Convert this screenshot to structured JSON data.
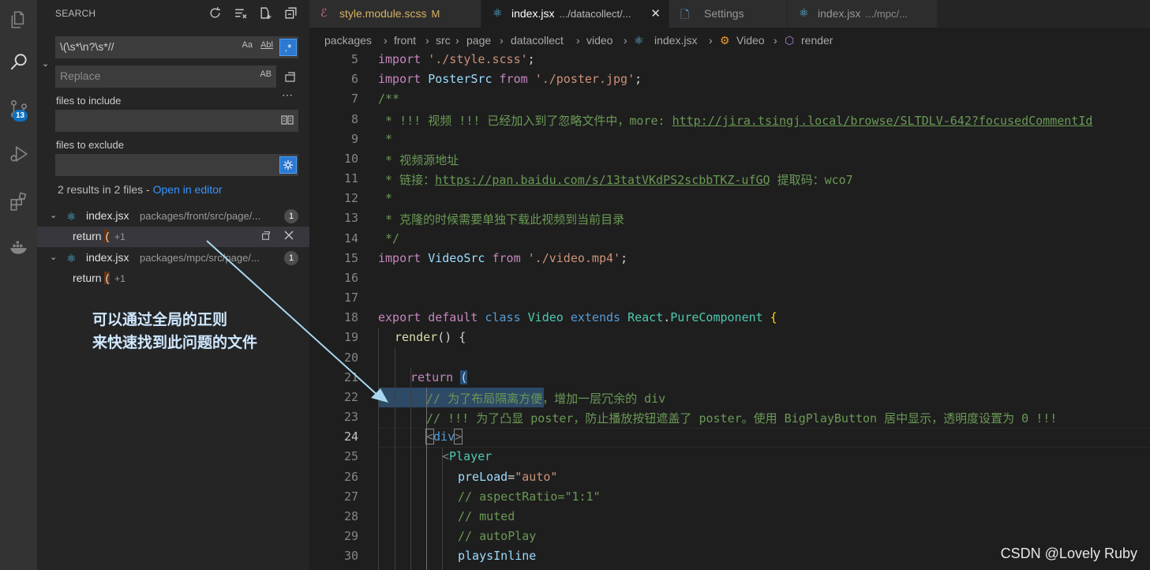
{
  "activity_bar": {
    "items": [
      "explorer-icon",
      "search-icon",
      "source-control-icon",
      "run-debug-icon",
      "extensions-icon",
      "docker-icon"
    ],
    "source_control_badge": "13"
  },
  "search": {
    "title": "SEARCH",
    "query": "\\(\\s*\\n?\\s*//",
    "replace_placeholder": "Replace",
    "match_case_label": "Aa",
    "whole_word_label": "Abl",
    "regex_label": ".*",
    "preserve_case_label": "AB",
    "files_to_include_label": "files to include",
    "files_to_exclude_label": "files to exclude",
    "summary": "2 results in 2 files - ",
    "open_in_editor": "Open in editor",
    "results": [
      {
        "file": "index.jsx",
        "path": "packages/front/src/page/...",
        "count": "1",
        "match_prefix": "return ",
        "match_hl": "(",
        "match_more": "+1"
      },
      {
        "file": "index.jsx",
        "path": "packages/mpc/src/page/...",
        "count": "1",
        "match_prefix": "return ",
        "match_hl": "(",
        "match_more": "+1"
      }
    ],
    "annotation_line1": "可以通过全局的正则",
    "annotation_line2": "来快速找到此问题的文件"
  },
  "tabs": [
    {
      "name": "style.module.scss",
      "desc": "",
      "mod": "M",
      "active": false
    },
    {
      "name": "index.jsx",
      "desc": ".../datacollect/...",
      "mod": "",
      "active": true
    },
    {
      "name": "Settings",
      "desc": "",
      "mod": "",
      "active": false
    },
    {
      "name": "index.jsx",
      "desc": ".../mpc/...",
      "mod": "",
      "active": false
    }
  ],
  "breadcrumbs": [
    "packages",
    "front",
    "src",
    "page",
    "datacollect",
    "video",
    "index.jsx",
    "Video",
    "render"
  ],
  "editor": {
    "line_numbers": [
      "5",
      "6",
      "7",
      "8",
      "9",
      "10",
      "11",
      "12",
      "13",
      "14",
      "15",
      "16",
      "17",
      "18",
      "19",
      "20",
      "21",
      "22",
      "23",
      "24",
      "25",
      "26",
      "27",
      "28",
      "29",
      "30"
    ],
    "current_line": "24",
    "l5_a": "import ",
    "l5_b": "'./style.scss'",
    "l5_c": ";",
    "l6_a": "import ",
    "l6_b": "PosterSrc",
    "l6_c": " from ",
    "l6_d": "'./poster.jpg'",
    "l6_e": ";",
    "l7": "/**",
    "l8_a": " * !!! 视频 !!! 已经加入到了忽略文件中，more: ",
    "l8_link": "http://jira.tsingj.local/browse/SLTDLV-642?focusedCommentId",
    "l9": " *",
    "l10": " * 视频源地址",
    "l11_a": " * 链接：",
    "l11_link": "https://pan.baidu.com/s/13tatVKdPS2scbbTKZ-ufGQ",
    "l11_b": " 提取码：wco7",
    "l12": " *",
    "l13": " * 克隆的时候需要单独下载此视频到当前目录",
    "l14": " */",
    "l15_a": "import ",
    "l15_b": "VideoSrc",
    "l15_c": " from ",
    "l15_d": "'./video.mp4'",
    "l15_e": ";",
    "l18_a": "export default ",
    "l18_b": "class ",
    "l18_c": "Video ",
    "l18_d": "extends ",
    "l18_e": "React",
    "l18_f": ".",
    "l18_g": "PureComponent",
    "l18_h": " {",
    "l19_a": "render",
    "l19_b": "() {",
    "l21_a": "return ",
    "l21_b": "(",
    "l22": "// 为了布局隔离方便，增加一层冗余的 div",
    "l23": "// !!! 为了凸显 poster，防止播放按钮遮盖了 poster。使用 BigPlayButton 居中显示，透明度设置为 0 !!!",
    "l24_a": "<",
    "l24_b": "div",
    "l24_c": ">",
    "l25_a": "<",
    "l25_b": "Player",
    "l26_a": "preLoad",
    "l26_b": "=",
    "l26_c": "\"auto\"",
    "l27": "// aspectRatio=\"1:1\"",
    "l28": "// muted",
    "l29": "// autoPlay",
    "l30": "playsInline"
  },
  "watermark": "CSDN @Lovely Ruby",
  "colors": {
    "accent": "#0e70c0",
    "regex_active": "#2b79d0",
    "link": "#3794ff",
    "annotation_arrow": "#a8d8ef"
  }
}
